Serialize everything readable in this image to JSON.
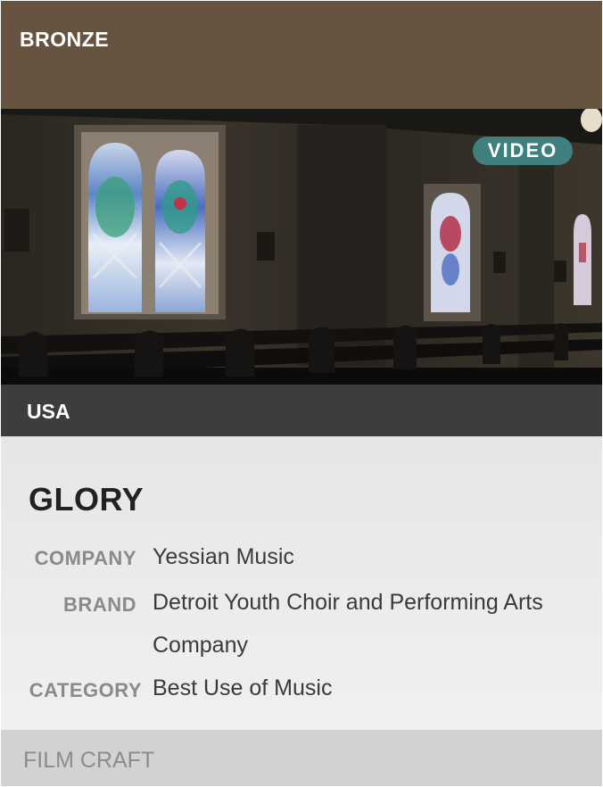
{
  "award": {
    "level": "BRONZE"
  },
  "media": {
    "badge": "VIDEO",
    "thumbnail_icon": "church-stained-glass-image"
  },
  "entry": {
    "country": "USA",
    "title": "GLORY",
    "details": [
      {
        "key": "COMPANY",
        "value": "Yessian Music"
      },
      {
        "key": "BRAND",
        "value": "Detroit Youth Choir and Performing Arts Company"
      },
      {
        "key": "CATEGORY",
        "value": "Best Use of Music"
      }
    ]
  },
  "section": {
    "label": "FILM CRAFT"
  },
  "colors": {
    "award_bar": "#675440",
    "badge": "#3f7f7e",
    "country_bar": "#3d3d3d",
    "section_bar": "#d2d2d2"
  }
}
